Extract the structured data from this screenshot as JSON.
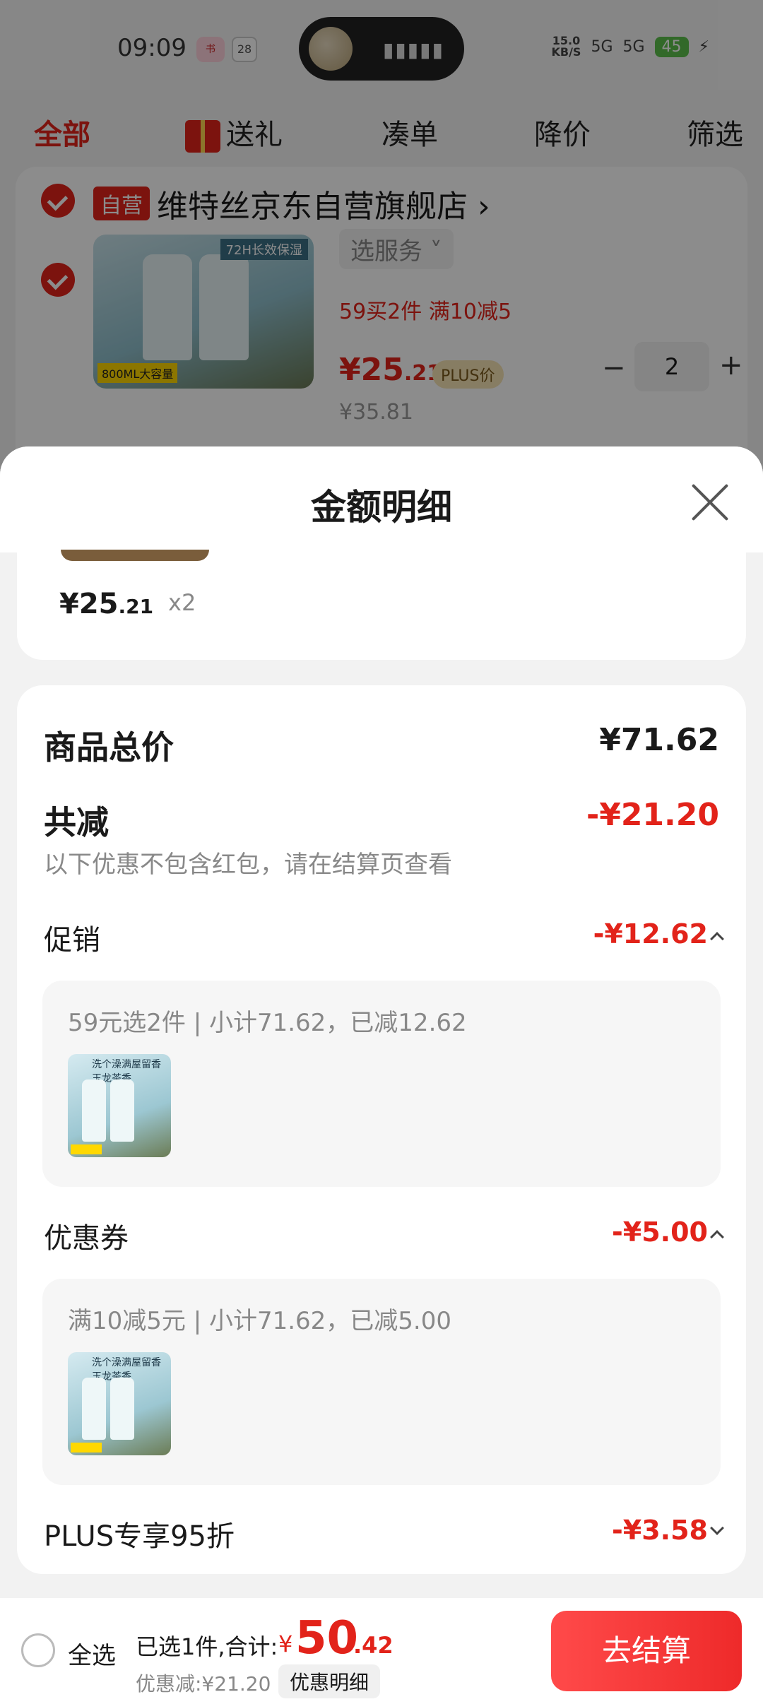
{
  "status": {
    "time": "09:09",
    "app_a": "小红书",
    "app_b": "28",
    "speed": "15.0",
    "speed_unit": "KB/S",
    "signal_a": "5G",
    "signal_b": "5G",
    "battery": "45"
  },
  "filters": {
    "all": "全部",
    "gift": "送礼",
    "combine": "凑单",
    "price_drop": "降价",
    "filter": "筛选"
  },
  "store": {
    "badge": "自营",
    "name": "维特丝京东自营旗舰店",
    "arrow": "›"
  },
  "item": {
    "image_tag": "72H长效保湿",
    "image_sticker": "800ML大容量",
    "service": "选服务 ˅",
    "promo": "59买2件  满10减5",
    "price_int": "¥25",
    "price_dec": ".21",
    "plus_tag": "PLUS价",
    "quantity": "2",
    "minus": "−",
    "plus": "+",
    "original_price": "¥35.81"
  },
  "sheet": {
    "title": "金额明细",
    "product": {
      "price_int": "¥25",
      "price_dec": ".21",
      "qty": "x2"
    },
    "total_label": "商品总价",
    "total_value": "¥71.62",
    "reduce_label": "共减",
    "reduce_value": "-¥21.20",
    "reduce_note": "以下优惠不包含红包，请在结算页查看",
    "sections": [
      {
        "label": "促销",
        "value": "-¥12.62",
        "desc": "59元选2件 | 小计71.62，已减12.62",
        "thumb_text": "洗个澡满屋留香 玉龙茶香"
      },
      {
        "label": "优惠券",
        "value": "-¥5.00",
        "desc": "满10减5元 | 小计71.62，已减5.00",
        "thumb_text": "洗个澡满屋留香 玉龙茶香"
      },
      {
        "label": "PLUS专享95折",
        "value": "-¥3.58"
      }
    ]
  },
  "bottom": {
    "select_all": "全选",
    "selected_total": "已选1件,合计:",
    "currency": "¥",
    "total_int": "50",
    "total_dec": ".42",
    "discount": "优惠减:¥21.20",
    "detail_button": "优惠明细",
    "checkout": "去结算"
  },
  "colors": {
    "accent": "#e2231a",
    "checkout_gradient_start": "#ff4a4a",
    "checkout_gradient_end": "#ee2a2a",
    "plus_tag_bg": "#f6e3b4"
  }
}
